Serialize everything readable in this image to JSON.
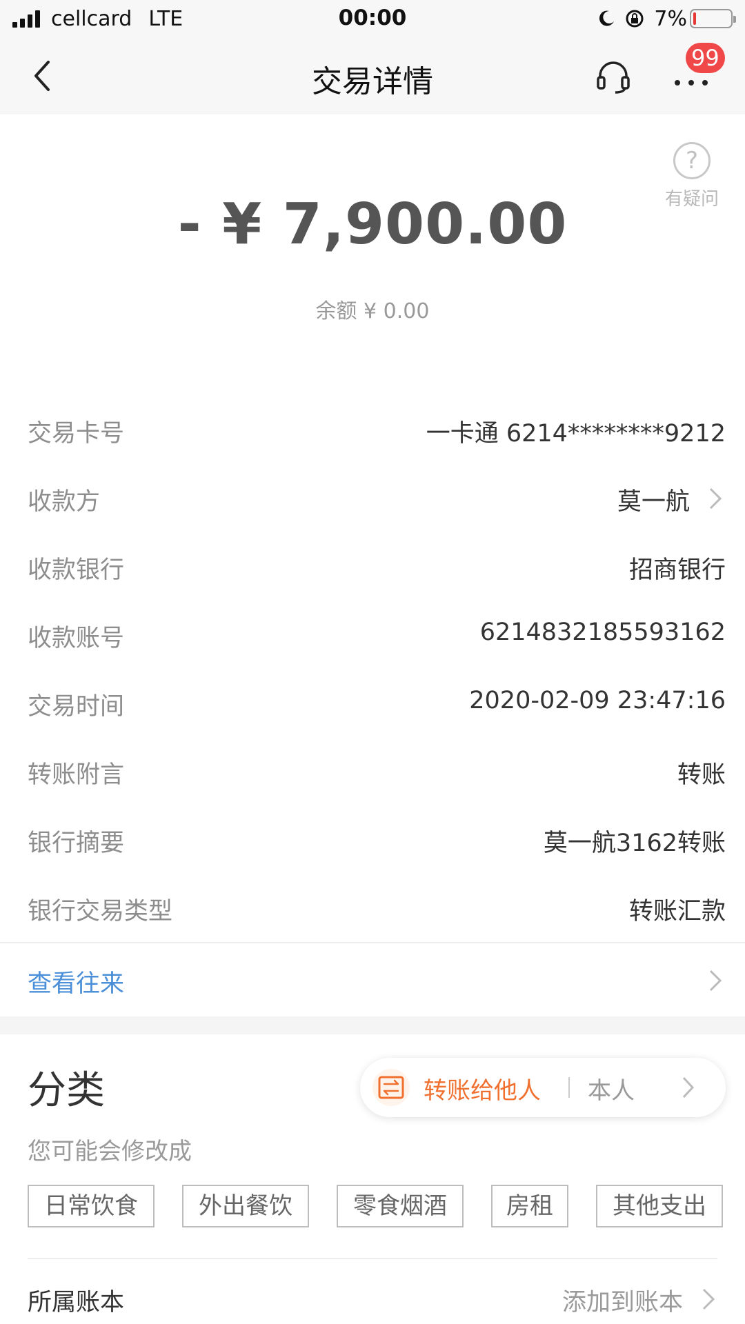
{
  "status_bar": {
    "carrier": "cellcard",
    "network": "LTE",
    "time": "00:00",
    "battery_text": "7%",
    "battery_level": 0.07
  },
  "nav": {
    "title": "交易详情",
    "badge_count": "99"
  },
  "help": {
    "label": "有疑问"
  },
  "amount": {
    "text": "- ¥  7,900.00",
    "balance": "余额 ¥ 0.00"
  },
  "details": [
    {
      "label": "交易卡号",
      "value": "一卡通 6214********9212"
    },
    {
      "label": "收款方",
      "value": "莫一航"
    },
    {
      "label": "收款银行",
      "value": "招商银行"
    },
    {
      "label": "收款账号",
      "value": "6214832185593162"
    },
    {
      "label": "交易时间",
      "value": "2020-02-09 23:47:16"
    },
    {
      "label": "转账附言",
      "value": "转账"
    },
    {
      "label": "银行摘要",
      "value": "莫一航3162转账"
    },
    {
      "label": "银行交易类型",
      "value": "转账汇款"
    }
  ],
  "contacts_link": "查看往来",
  "category": {
    "title": "分类",
    "pill_primary": "转账给他人",
    "pill_secondary": "本人",
    "hint": "您可能会修改成",
    "tags": [
      "日常饮食",
      "外出餐饮",
      "零食烟酒",
      "房租",
      "其他支出"
    ]
  },
  "book": {
    "label": "所属账本",
    "action": "添加到账本"
  },
  "colors": {
    "accent_orange": "#f07030",
    "link_blue": "#4a8fd8",
    "badge_red": "#f04848",
    "battery_red": "#e53935"
  }
}
